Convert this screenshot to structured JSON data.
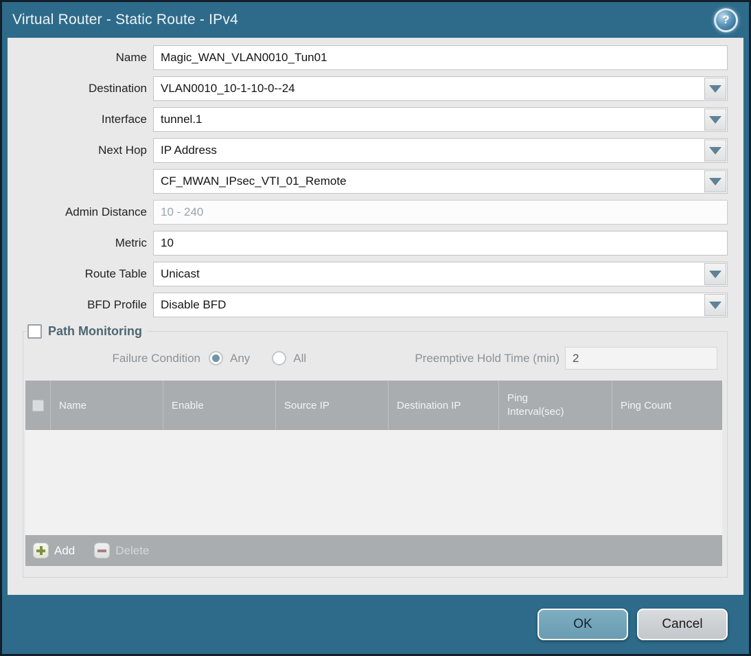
{
  "titlebar": {
    "title": "Virtual Router - Static Route - IPv4",
    "help_glyph": "?"
  },
  "form": {
    "name": {
      "label": "Name",
      "value": "Magic_WAN_VLAN0010_Tun01"
    },
    "destination": {
      "label": "Destination",
      "value": "VLAN0010_10-1-10-0--24"
    },
    "interface": {
      "label": "Interface",
      "value": "tunnel.1"
    },
    "next_hop": {
      "label": "Next Hop",
      "value": "IP Address"
    },
    "next_hop_address": {
      "value": "CF_MWAN_IPsec_VTI_01_Remote"
    },
    "admin_distance": {
      "label": "Admin Distance",
      "value": "",
      "placeholder": "10 - 240"
    },
    "metric": {
      "label": "Metric",
      "value": "10"
    },
    "route_table": {
      "label": "Route Table",
      "value": "Unicast"
    },
    "bfd_profile": {
      "label": "BFD Profile",
      "value": "Disable BFD"
    }
  },
  "path_monitoring": {
    "title": "Path Monitoring",
    "enabled": false,
    "failure_condition": {
      "label": "Failure Condition",
      "options": [
        "Any",
        "All"
      ],
      "selected": "Any"
    },
    "preemptive_hold_time": {
      "label": "Preemptive Hold Time (min)",
      "value": "2"
    },
    "table": {
      "columns": [
        "Name",
        "Enable",
        "Source IP",
        "Destination IP",
        "Ping Interval(sec)",
        "Ping Count"
      ],
      "rows": []
    },
    "toolbar": {
      "add_label": "Add",
      "delete_label": "Delete",
      "delete_enabled": false
    }
  },
  "footer": {
    "ok_label": "OK",
    "cancel_label": "Cancel"
  },
  "colors": {
    "titlebar": "#2e6b8a",
    "content_bg": "#e9e9e9",
    "table_header": "#a9adb0",
    "radio_selected": "#7195a6",
    "ok_button": "#74a6bb",
    "add_icon": "#7d923d",
    "delete_icon": "#aa7f7b"
  }
}
